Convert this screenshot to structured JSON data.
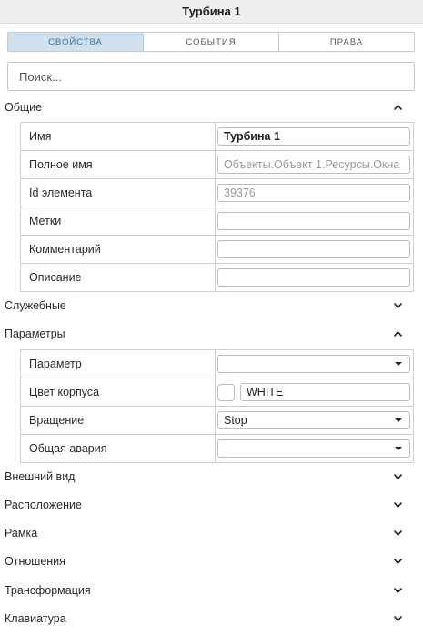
{
  "window": {
    "title": "Турбина 1"
  },
  "tabs": [
    {
      "label": "СВОЙСТВА",
      "active": true
    },
    {
      "label": "СОБЫТИЯ",
      "active": false
    },
    {
      "label": "ПРАВА",
      "active": false
    }
  ],
  "search": {
    "placeholder": "Поиск...",
    "value": ""
  },
  "sections": {
    "general": {
      "label": "Общие",
      "expanded": true
    },
    "service": {
      "label": "Служебные",
      "expanded": false
    },
    "params": {
      "label": "Параметры",
      "expanded": true
    },
    "appearance": {
      "label": "Внешний вид",
      "expanded": false
    },
    "location": {
      "label": "Расположение",
      "expanded": false
    },
    "frame": {
      "label": "Рамка",
      "expanded": false
    },
    "relations": {
      "label": "Отношения",
      "expanded": false
    },
    "transform": {
      "label": "Трансформация",
      "expanded": false
    },
    "keyboard": {
      "label": "Клавиатура",
      "expanded": false
    }
  },
  "general_props": {
    "name": {
      "label": "Имя",
      "value": "Турбина 1"
    },
    "full_name": {
      "label": "Полное имя",
      "value": "Объекты.Объект 1.Ресурсы.Окна"
    },
    "id": {
      "label": "Id элемента",
      "value": "39376"
    },
    "tags": {
      "label": "Метки",
      "value": ""
    },
    "comment": {
      "label": "Комментарий",
      "value": ""
    },
    "description": {
      "label": "Описание",
      "value": ""
    }
  },
  "param_props": {
    "parameter": {
      "label": "Параметр",
      "value": ""
    },
    "body_color": {
      "label": "Цвет корпуса",
      "value": "WHITE",
      "swatch": "#ffffff"
    },
    "rotation": {
      "label": "Вращение",
      "value": "Stop"
    },
    "alarm": {
      "label": "Общая авария",
      "value": ""
    }
  },
  "icons": {
    "collapse": "chevron-up-icon",
    "expand": "chevron-down-icon",
    "dropdown": "caret-down-icon"
  }
}
